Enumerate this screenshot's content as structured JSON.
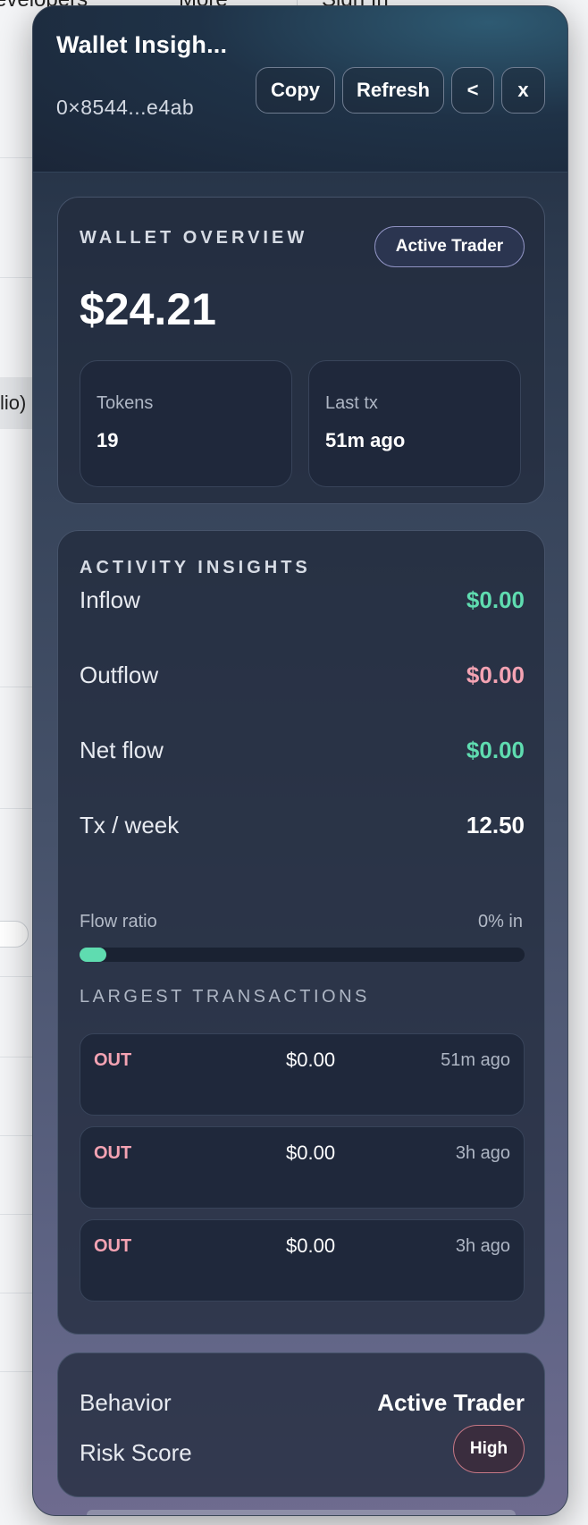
{
  "background": {
    "nav_left": "evelopers",
    "nav_more": "More",
    "sign_in": "Sign In",
    "chip_text": "lio)"
  },
  "panel": {
    "title": "Wallet Insigh...",
    "address": "0×8544...e4ab",
    "buttons": {
      "copy": "Copy",
      "refresh": "Refresh",
      "back": "<",
      "close": "x"
    }
  },
  "overview": {
    "title": "WALLET OVERVIEW",
    "badge": "Active Trader",
    "total_value": "$24.21",
    "stats": {
      "tokens_label": "Tokens",
      "tokens_value": "19",
      "last_tx_label": "Last tx",
      "last_tx_value": "51m ago"
    }
  },
  "activity": {
    "title": "ACTIVITY INSIGHTS",
    "metrics": [
      {
        "label": "Inflow",
        "value": "$0.00",
        "color": "#5fdcb0"
      },
      {
        "label": "Outflow",
        "value": "$0.00",
        "color": "#f4a3b3"
      },
      {
        "label": "Net flow",
        "value": "$0.00",
        "color": "#5fdcb0"
      },
      {
        "label": "Tx / week",
        "value": "12.50",
        "color": "#ffffff"
      }
    ],
    "flow_ratio_label": "Flow ratio",
    "flow_ratio_value": "0% in",
    "flow_ratio_fraction": 0,
    "largest_title": "LARGEST TRANSACTIONS",
    "transactions": [
      {
        "direction": "OUT",
        "amount": "$0.00",
        "time": "51m ago"
      },
      {
        "direction": "OUT",
        "amount": "$0.00",
        "time": "3h ago"
      },
      {
        "direction": "OUT",
        "amount": "$0.00",
        "time": "3h ago"
      }
    ]
  },
  "behavior": {
    "behavior_label": "Behavior",
    "behavior_value": "Active Trader",
    "risk_label": "Risk Score",
    "risk_value": "High"
  },
  "colors": {
    "inflow": "#5fdcb0",
    "outflow": "#f4a3b3",
    "accent": "#8f92c2"
  }
}
